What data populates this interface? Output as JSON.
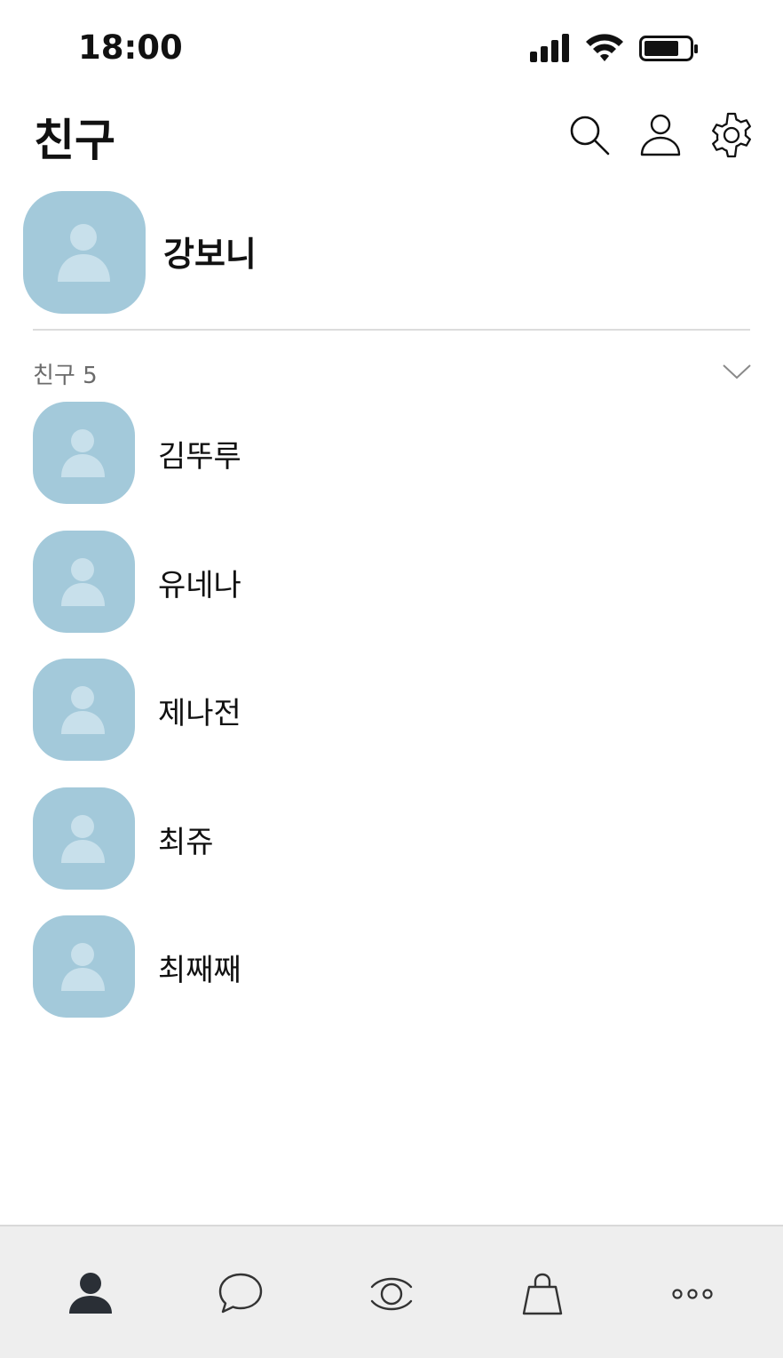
{
  "status_bar": {
    "time": "18:00",
    "icons": [
      "cellular-signal-icon",
      "wifi-icon",
      "battery-icon"
    ]
  },
  "header": {
    "title": "친구",
    "actions": [
      {
        "name": "search-icon"
      },
      {
        "name": "add-friend-icon"
      },
      {
        "name": "gear-icon"
      }
    ]
  },
  "my_profile": {
    "name": "강보니"
  },
  "friends_section": {
    "label": "친구 5",
    "toggle_icon": "chevron-down-icon",
    "friends": [
      {
        "name": "김뚜루"
      },
      {
        "name": "유네나"
      },
      {
        "name": "제나전"
      },
      {
        "name": "최쥬"
      },
      {
        "name": "최째째"
      }
    ]
  },
  "tabbar": {
    "tabs": [
      {
        "icon": "friends-tab-icon",
        "active": true
      },
      {
        "icon": "chat-tab-icon",
        "active": false
      },
      {
        "icon": "view-tab-icon",
        "active": false
      },
      {
        "icon": "shopping-tab-icon",
        "active": false
      },
      {
        "icon": "more-tab-icon",
        "active": false
      }
    ]
  },
  "colors": {
    "avatar_bg": "#a3c9da",
    "avatar_figure": "#c8e0eb",
    "tabbar_bg": "#eeeeee",
    "active_tab": "#2a2f36",
    "inactive_tab": "#333333"
  }
}
